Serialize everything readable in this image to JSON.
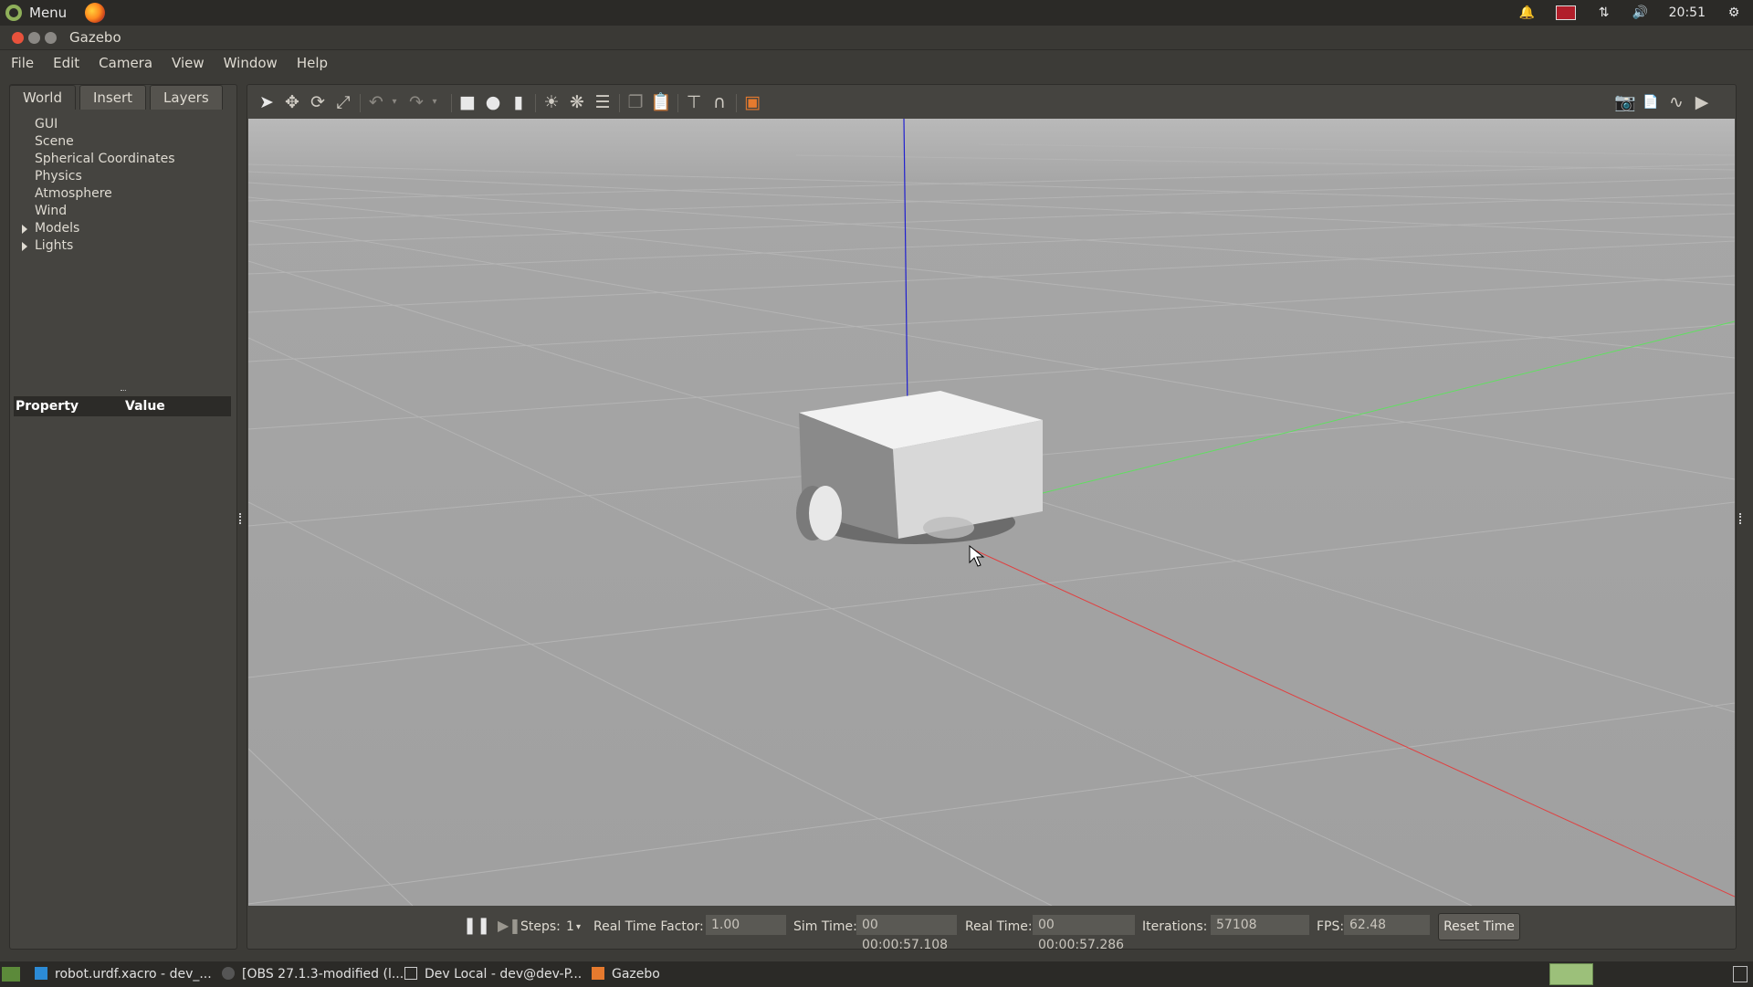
{
  "system_panel": {
    "menu_label": "Menu",
    "clock": "20:51"
  },
  "window": {
    "title": "Gazebo"
  },
  "menubar": {
    "items": [
      "File",
      "Edit",
      "Camera",
      "View",
      "Window",
      "Help"
    ]
  },
  "left_panel": {
    "tabs": [
      "World",
      "Insert",
      "Layers"
    ],
    "active_tab": "World",
    "tree": [
      {
        "label": "GUI",
        "expandable": false
      },
      {
        "label": "Scene",
        "expandable": false
      },
      {
        "label": "Spherical Coordinates",
        "expandable": false
      },
      {
        "label": "Physics",
        "expandable": false
      },
      {
        "label": "Atmosphere",
        "expandable": false
      },
      {
        "label": "Wind",
        "expandable": false
      },
      {
        "label": "Models",
        "expandable": true
      },
      {
        "label": "Lights",
        "expandable": true
      }
    ],
    "property_header": {
      "property": "Property",
      "value": "Value"
    }
  },
  "toolbar": {
    "icons": [
      "select-arrow-icon",
      "translate-icon",
      "rotate-icon",
      "scale-icon",
      "undo-icon",
      "redo-icon",
      "box-shape-icon",
      "sphere-shape-icon",
      "cylinder-shape-icon",
      "point-light-icon",
      "spot-light-icon",
      "directional-light-icon",
      "copy-icon",
      "paste-icon",
      "align-icon",
      "snap-icon",
      "view-angle-icon",
      "screenshot-icon",
      "log-icon",
      "plot-icon",
      "record-video-icon"
    ]
  },
  "sim_bar": {
    "steps_label": "Steps:",
    "steps_value": "1",
    "rtf_label": "Real Time Factor:",
    "rtf_value": "1.00",
    "sim_time_label": "Sim Time:",
    "sim_time_value": "00 00:00:57.108",
    "real_time_label": "Real Time:",
    "real_time_value": "00 00:00:57.286",
    "iterations_label": "Iterations:",
    "iterations_value": "57108",
    "fps_label": "FPS:",
    "fps_value": "62.48",
    "reset_label": "Reset Time"
  },
  "taskbar": {
    "tasks": [
      {
        "label": "robot.urdf.xacro - dev_...",
        "icon": "vscode-icon"
      },
      {
        "label": "[OBS 27.1.3-modified (l...",
        "icon": "obs-icon"
      },
      {
        "label": "Dev Local - dev@dev-P...",
        "icon": "terminal-icon"
      },
      {
        "label": "Gazebo",
        "icon": "gazebo-icon"
      }
    ]
  },
  "colors": {
    "viewport_bg": "#a3a3a3",
    "axis_z": "#2020d0",
    "axis_x": "#e04040",
    "axis_y": "#60e060"
  }
}
